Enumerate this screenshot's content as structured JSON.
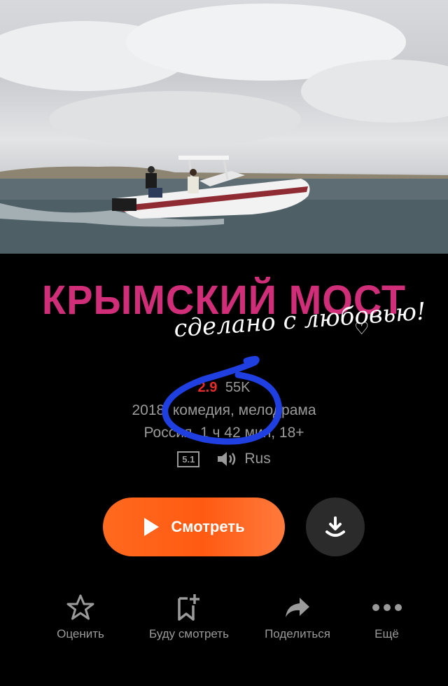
{
  "title": {
    "main": "КРЫМСКИЙ МОСТ",
    "script": "сделано с любовью!"
  },
  "rating": {
    "value": "2.9",
    "count": "55K"
  },
  "meta": {
    "line1": "2018, комедия, мелодрама",
    "line2": "Россия, 1 ч 42 мин, 18+"
  },
  "tech": {
    "sound_badge": "5.1",
    "audio_lang": "Rus"
  },
  "buttons": {
    "watch": "Смотреть"
  },
  "actions": [
    {
      "label": "Оценить",
      "icon": "star-icon"
    },
    {
      "label": "Буду смотреть",
      "icon": "bookmark-add-icon"
    },
    {
      "label": "Поделиться",
      "icon": "share-icon"
    },
    {
      "label": "Ещё",
      "icon": "more-dots-icon"
    }
  ],
  "colors": {
    "title": "#d12e7a",
    "rating": "#e52b2b",
    "watch_button": "#ff5a12",
    "annotation": "#1f3fe0",
    "muted_text": "#9a9a9a"
  }
}
